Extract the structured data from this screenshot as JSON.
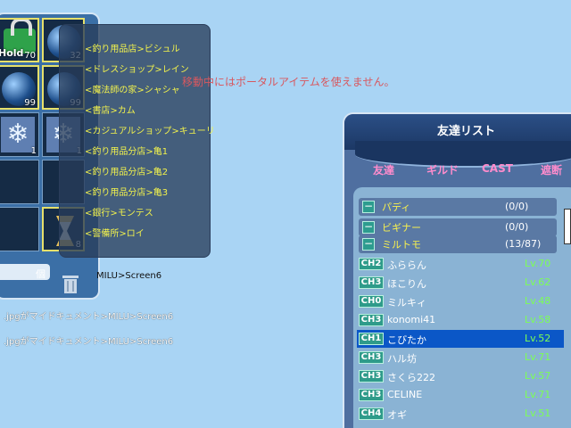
{
  "inventory": {
    "hold_label": "Hold",
    "slots": [
      {
        "item": "lock-item",
        "quantity": "70"
      },
      {
        "item": "orb-item",
        "quantity": "32"
      },
      {
        "item": "orb-item",
        "quantity": "99"
      },
      {
        "item": "orb-item",
        "quantity": "99"
      },
      {
        "item": "snow-item",
        "quantity": "1"
      },
      {
        "item": "snow-item",
        "quantity": "1"
      },
      {
        "item": "empty",
        "quantity": ""
      },
      {
        "item": "empty",
        "quantity": ""
      },
      {
        "item": "empty",
        "quantity": ""
      },
      {
        "item": "hourglass-item",
        "quantity": "8"
      }
    ],
    "unit_label": "個"
  },
  "portal_menu": {
    "items": [
      "<釣り用品店>ビシュル",
      "<ドレスショップ>レイン",
      "<魔法師の家>シャシャ",
      "<書店>カム",
      "<カジュアルショップ>キューリ",
      "<釣り用品分店>亀1",
      "<釣り用品分店>亀2",
      "<釣り用品分店>亀3",
      "<銀行>モンテス",
      "<警備所>ロイ"
    ]
  },
  "chat": {
    "lines": [
      {
        "text": "MILU>Screen6"
      },
      {
        "text": ".jpgがマイドキュメント>MILU>Screen6"
      },
      {
        "text": ".jpgがマイドキュメント>MILU>Screen6"
      }
    ]
  },
  "system_message": "移動中にはポータルアイテムを使えません。",
  "friend_list": {
    "title": "友達リスト",
    "tabs": [
      "友達",
      "ギルド",
      "CAST",
      "遮断"
    ],
    "groups": [
      {
        "name": "パディ",
        "count": "(0/0)"
      },
      {
        "name": "ビギナー",
        "count": "(0/0)"
      },
      {
        "name": "ミルトモ",
        "count": "(13/87)"
      }
    ],
    "friends": [
      {
        "channel": "CH2",
        "name": "ふららん",
        "level": "Lv.70",
        "selected": false
      },
      {
        "channel": "CH3",
        "name": "ほこりん",
        "level": "Lv.62",
        "selected": false
      },
      {
        "channel": "CH0",
        "name": "ミルキィ",
        "level": "Lv.48",
        "selected": false
      },
      {
        "channel": "CH3",
        "name": "konomi41",
        "level": "Lv.58",
        "selected": false
      },
      {
        "channel": "CH1",
        "name": "こびたか",
        "level": "Lv.52",
        "selected": true
      },
      {
        "channel": "CH3",
        "name": "ハル坊",
        "level": "Lv.71",
        "selected": false
      },
      {
        "channel": "CH3",
        "name": "さくら222",
        "level": "Lv.57",
        "selected": false
      },
      {
        "channel": "CH3",
        "name": "CELINE",
        "level": "Lv.71",
        "selected": false
      },
      {
        "channel": "CH4",
        "name": "オギ",
        "level": "Lv.51",
        "selected": false
      }
    ]
  },
  "colors": {
    "background": "#a9d4f4",
    "menu_text": "#f2f24c",
    "system_text": "#d8585f",
    "tab_text": "#ff8ccc",
    "level_text": "#7cff54",
    "selected_row": "#0b57c7"
  }
}
